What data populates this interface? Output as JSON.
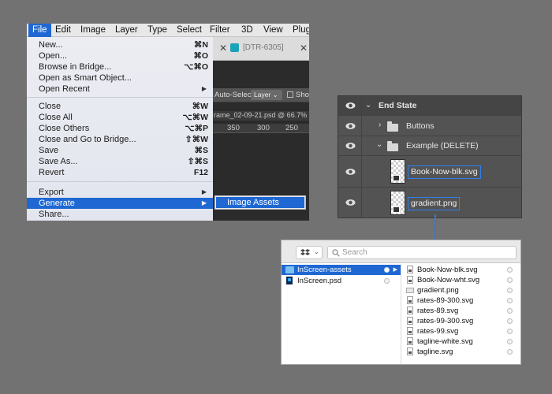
{
  "menubar": {
    "items": [
      "File",
      "Edit",
      "Image",
      "Layer",
      "Type",
      "Select",
      "Filter",
      "3D",
      "View",
      "Plug"
    ]
  },
  "background": {
    "doc_tab_label": "[DTR-6305]",
    "options": {
      "auto_select_label": "Auto-Select:",
      "layer_select": "Layer",
      "show_label": "Show"
    },
    "document_tab": "rame_02-09-21.psd @ 66.7%",
    "ruler": [
      "350",
      "300",
      "250"
    ]
  },
  "file_menu": {
    "items": [
      {
        "label": "New...",
        "shortcut": "⌘N"
      },
      {
        "label": "Open...",
        "shortcut": "⌘O"
      },
      {
        "label": "Browse in Bridge...",
        "shortcut": "⌥⌘O"
      },
      {
        "label": "Open as Smart Object...",
        "shortcut": ""
      },
      {
        "label": "Open Recent",
        "shortcut": "▶"
      },
      {
        "label": "Close",
        "shortcut": "⌘W"
      },
      {
        "label": "Close All",
        "shortcut": "⌥⌘W"
      },
      {
        "label": "Close Others",
        "shortcut": "⌥⌘P"
      },
      {
        "label": "Close and Go to Bridge...",
        "shortcut": "⇧⌘W"
      },
      {
        "label": "Save",
        "shortcut": "⌘S"
      },
      {
        "label": "Save As...",
        "shortcut": "⇧⌘S"
      },
      {
        "label": "Revert",
        "shortcut": "F12"
      },
      {
        "label": "Export",
        "shortcut": "▶"
      },
      {
        "label": "Generate",
        "shortcut": "▶"
      },
      {
        "label": "Share...",
        "shortcut": ""
      }
    ],
    "submenu": {
      "label": "Image Assets"
    }
  },
  "layers": {
    "rows": [
      {
        "name": "End State"
      },
      {
        "name": "Buttons"
      },
      {
        "name": "Example (DELETE)"
      },
      {
        "name": "Book-Now-blk.svg"
      },
      {
        "name": "gradient.png"
      }
    ]
  },
  "finder": {
    "search_placeholder": "Search",
    "column1": [
      "InScreen-assets",
      "InScreen.psd"
    ],
    "column2": [
      "Book-Now-blk.svg",
      "Book-Now-wht.svg",
      "gradient.png",
      "rates-89-300.svg",
      "rates-89.svg",
      "rates-99-300.svg",
      "rates-99.svg",
      "tagline-white.svg",
      "tagline.svg"
    ]
  },
  "colors": {
    "selection": "#1f68d3",
    "highlight_box": "#2f7ff2",
    "arrow": "#2d7be0"
  }
}
